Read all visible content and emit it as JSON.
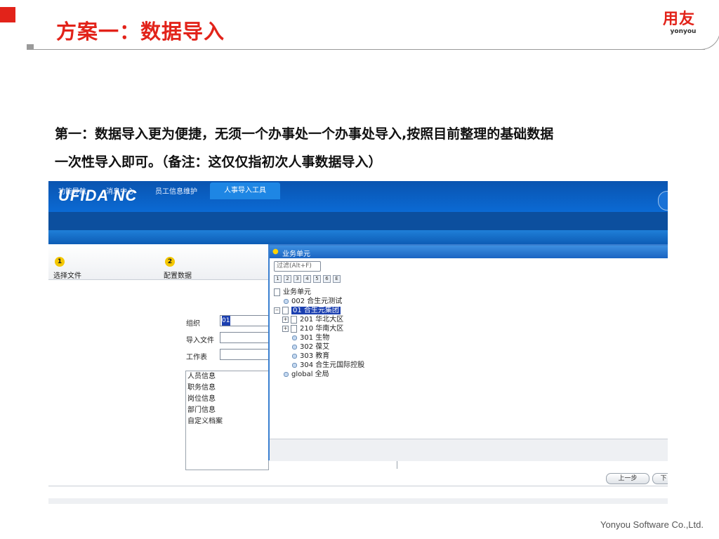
{
  "slide": {
    "title": "方案一：数据导入",
    "logo_cn": "用友",
    "logo_en": "yonyou",
    "body_line1": "第一：数据导入更为便捷，无须一个办事处一个办事处导入,按照目前整理的基础数据",
    "body_line2": "一次性导入即可。（备注：这仅仅指初次人事数据导入）",
    "footer": "Yonyou Software Co.,Ltd."
  },
  "colors": {
    "brand_red": "#e2231a",
    "app_blue": "#0b6ad4"
  },
  "app": {
    "logo": "UFIDA NC",
    "nav_tabs": [
      "功能导航",
      "消息中心",
      "员工信息维护"
    ],
    "active_tab": "人事导入工具",
    "steps": [
      {
        "num": "1",
        "label": "选择文件"
      },
      {
        "num": "2",
        "label": "配置数据"
      }
    ],
    "form": {
      "org_label": "组织",
      "org_value": "01",
      "file_label": "导入文件",
      "sheet_label": "工作表"
    },
    "list_items": [
      "人员信息",
      "职务信息",
      "岗位信息",
      "部门信息",
      "自定义档案"
    ],
    "prev_button": "上一步",
    "next_button": "下"
  },
  "dialog": {
    "title": "业务单元",
    "filter_placeholder": "过滤(Alt+F)",
    "level_buttons": [
      "1",
      "2",
      "3",
      "4",
      "5",
      "6",
      "E"
    ],
    "tree": {
      "root": "业务单元",
      "n002": "002 合生元测试",
      "n01": "01 合生元集团",
      "n201": "201 华北大区",
      "n210": "210 华南大区",
      "n301": "301 生物",
      "n302": "302 葆艾",
      "n303": "303 教育",
      "n304": "304 合生元国际控股",
      "global": "global 全局"
    }
  }
}
